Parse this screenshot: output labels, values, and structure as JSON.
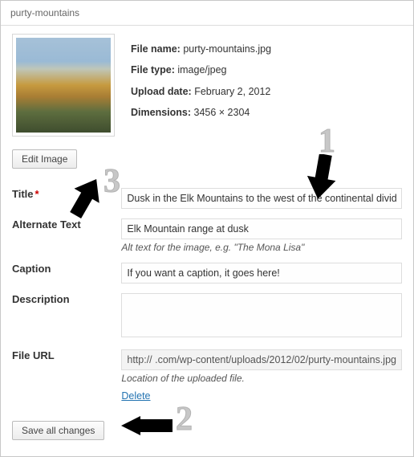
{
  "header": {
    "title": "purty-mountains"
  },
  "meta": {
    "filename_label": "File name:",
    "filename": "purty-mountains.jpg",
    "filetype_label": "File type:",
    "filetype": "image/jpeg",
    "upload_label": "Upload date:",
    "upload_date": "February 2, 2012",
    "dimensions_label": "Dimensions:",
    "dimensions": "3456 × 2304"
  },
  "buttons": {
    "edit_image": "Edit Image",
    "save_all": "Save all changes"
  },
  "fields": {
    "title_label": "Title",
    "title_value": "Dusk in the Elk Mountains to the west of the continental divide",
    "alt_label": "Alternate Text",
    "alt_value": "Elk Mountain range at dusk",
    "alt_hint": "Alt text for the image, e.g. \"The Mona Lisa\"",
    "caption_label": "Caption",
    "caption_value": "If you want a caption, it goes here!",
    "desc_label": "Description",
    "desc_value": "",
    "fileurl_label": "File URL",
    "fileurl_value": "http://        .com/wp-content/uploads/2012/02/purty-mountains.jpg",
    "fileurl_hint": "Location of the uploaded file.",
    "delete": "Delete"
  },
  "annotations": {
    "n1": "1",
    "n2": "2",
    "n3": "3"
  }
}
